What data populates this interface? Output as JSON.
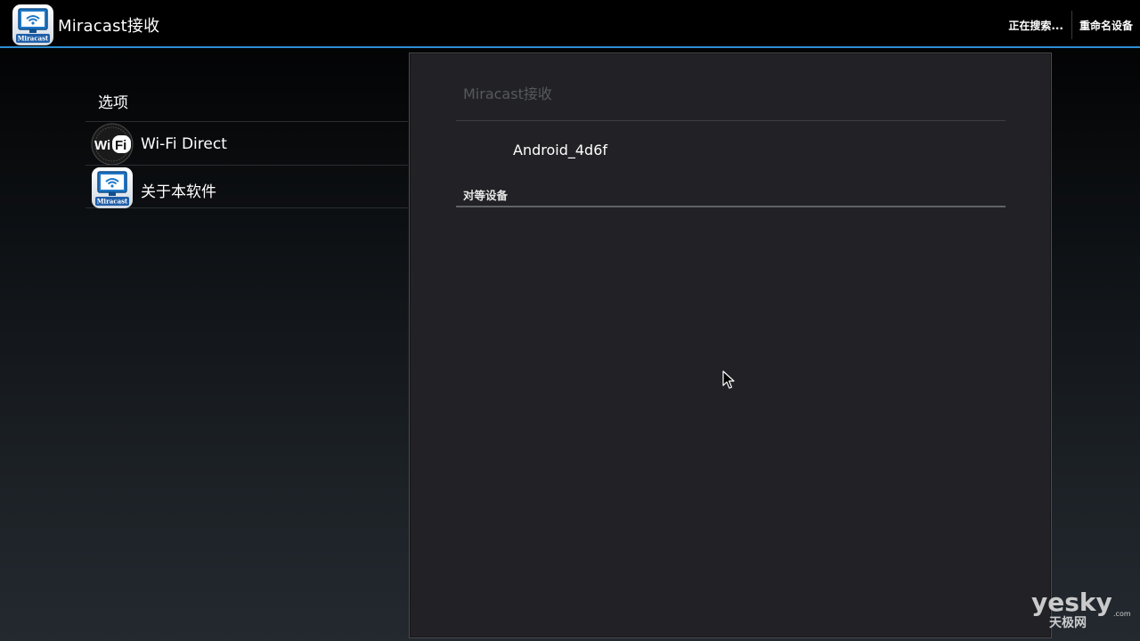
{
  "actionbar": {
    "title": "Miracast接收",
    "searching_label": "正在搜索...",
    "rename_label": "重命名设备"
  },
  "headers": {
    "title": "选项",
    "items": [
      {
        "label": "Wi-Fi Direct",
        "icon": "wifi-logo-icon"
      },
      {
        "label": "关于本软件",
        "icon": "miracast-app-icon"
      }
    ]
  },
  "pane": {
    "title": "Miracast接收",
    "device_name": "Android_4d6f",
    "peers_label": "对等设备"
  },
  "icons": {
    "app_icon_label": "Miracast",
    "wifi_text_left": "Wi",
    "wifi_text_right": "Fi"
  },
  "watermark": {
    "main": "yesky",
    "dotcom": ".com",
    "sub": "天极网"
  },
  "colors": {
    "accent": "#2d8fd4",
    "pane_bg": "#222226",
    "muted_text": "#55585c"
  }
}
